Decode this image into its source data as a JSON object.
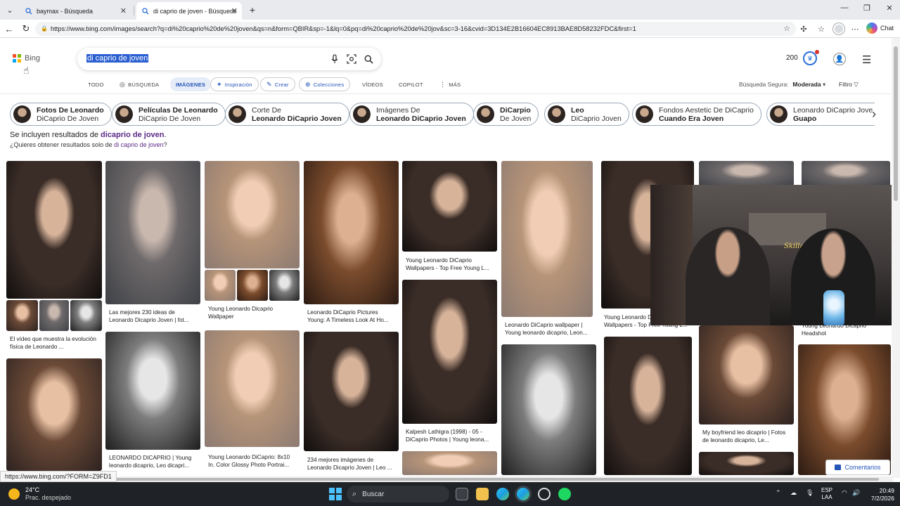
{
  "browser": {
    "tabs": [
      {
        "title": "baymax - Búsqueda",
        "active": false
      },
      {
        "title": "di caprio de joven - Búsqueda Ima",
        "active": true
      }
    ],
    "url": "https://www.bing.com/images/search?q=di%20caprio%20de%20joven&qs=n&form=QBIR&sp=-1&lq=0&pq=di%20caprio%20de%20jov&sc=3-16&cvid=3D134E2B16604EC8913BAE8D58232FDC&first=1",
    "chat_label": "Chat",
    "status_url": "https://www.bing.com/?FORM=Z9FD1"
  },
  "header": {
    "logo_text": "Bing",
    "query": "di caprio de joven",
    "points": "200"
  },
  "nav": {
    "items": [
      "TODO",
      "BÚSQUEDA",
      "IMÁGENES",
      "Inspiración",
      "Crear",
      "Colecciones",
      "VÍDEOS",
      "COPILOT",
      "MÁS"
    ],
    "safe_label": "Búsqueda Segura:",
    "safe_value": "Moderada",
    "filter_label": "Filtro"
  },
  "chips": [
    {
      "l1": "Fotos De Leonardo",
      "l2": "DiCaprio De Joven",
      "bold": 1
    },
    {
      "l1": "Películas De Leonardo",
      "l2": "DiCaprio De Joven",
      "bold": 1
    },
    {
      "l1": "Corte De",
      "l2": "Leonardo DiCaprio Joven",
      "bold": 2
    },
    {
      "l1": "Imágenes De",
      "l2": "Leonardo DiCaprio Joven",
      "bold": 2
    },
    {
      "l1": "DiCarpio",
      "l2": "De Joven",
      "bold": 1
    },
    {
      "l1": "Leo",
      "l2": "DiCaprio Joven",
      "bold": 1
    },
    {
      "l1": "Fondos Aestetic De DiCaprio",
      "l2": "Cuando Era Joven",
      "bold": 2
    },
    {
      "l1": "Leonardo DiCaprio Jove",
      "l2": "Guapo",
      "bold": 2
    }
  ],
  "notice": {
    "prefix": "Se incluyen resultados de ",
    "term": "dicaprio de joven",
    "suffix": ".",
    "q_prefix": "¿Quieres obtener resultados solo de ",
    "q_link": "di caprio de joven",
    "q_suffix": "?"
  },
  "results": {
    "captions": [
      "El vídeo que muestra la evolución física de Leonardo ...",
      "Las mejores 230 ideas de Leonardo Dicaprio Joven | fot...",
      "Young Leonardo Dicaprio Wallpaper",
      "Leonardo DiCaprio Pictures Young: A Timeless Look At Ho...",
      "Young Leonardo DiCaprio Wallpapers - Top Free Young L...",
      "Leonardo DiCaprio wallpaper | Young leonardo dicaprio, Leon...",
      "Young Leonardo DiCaprio Wallpapers - Top Free Young L...",
      "Young Leonardo Dicaprio Headshot",
      "LEONARDO DICAPRIO | Young leonardo dicaprio, Leo dicapri...",
      "Young Leonardo DiCaprio: 8x10 In. Color Glossy Photo Portrai...",
      "234 mejores imágenes de Leonardo Dicaprio Joven | Leo ...",
      "Kalpesh Lathigra (1998) - 05 - DiCaprio Photos | Young leona...",
      "My boyfriend leo dicaprio | Fotos de leonardo dicaprio, Le..."
    ],
    "comments_label": "Comentarios"
  },
  "taskbar": {
    "temp": "24°C",
    "weather": "Prac. despejado",
    "search_label": "Buscar",
    "lang_1": "ESP",
    "lang_2": "LAA",
    "time": "20:49",
    "date": "7/2/2026"
  },
  "overlay": {
    "sign": "Skillgr"
  }
}
